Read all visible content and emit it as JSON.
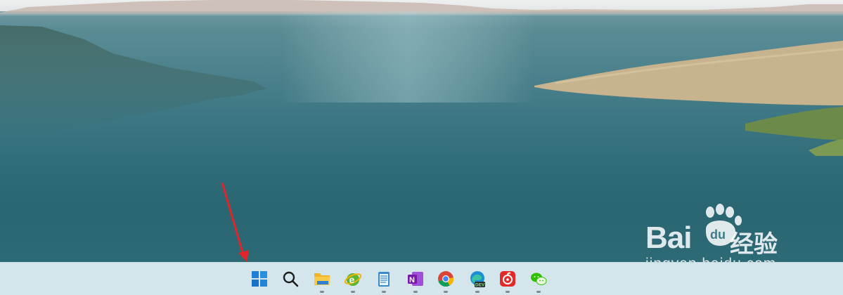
{
  "watermark": {
    "brand": "Bai",
    "brand_cn": "经验",
    "url": "jingyan.baidu.com"
  },
  "taskbar": {
    "items": [
      {
        "icon": "windows-start-icon",
        "running": false
      },
      {
        "icon": "search-icon",
        "running": false
      },
      {
        "icon": "file-explorer-icon",
        "running": true
      },
      {
        "icon": "internet-explorer-icon",
        "running": true
      },
      {
        "icon": "notepad-icon",
        "running": true
      },
      {
        "icon": "onenote-icon",
        "running": true,
        "label": "N"
      },
      {
        "icon": "chrome-icon",
        "running": true
      },
      {
        "icon": "edge-dev-icon",
        "running": true,
        "label": "DEV"
      },
      {
        "icon": "netease-music-icon",
        "running": true
      },
      {
        "icon": "wechat-icon",
        "running": true
      }
    ]
  },
  "colors": {
    "taskbar_bg": "#d4e6ec",
    "annotation_arrow": "#e0262a"
  }
}
